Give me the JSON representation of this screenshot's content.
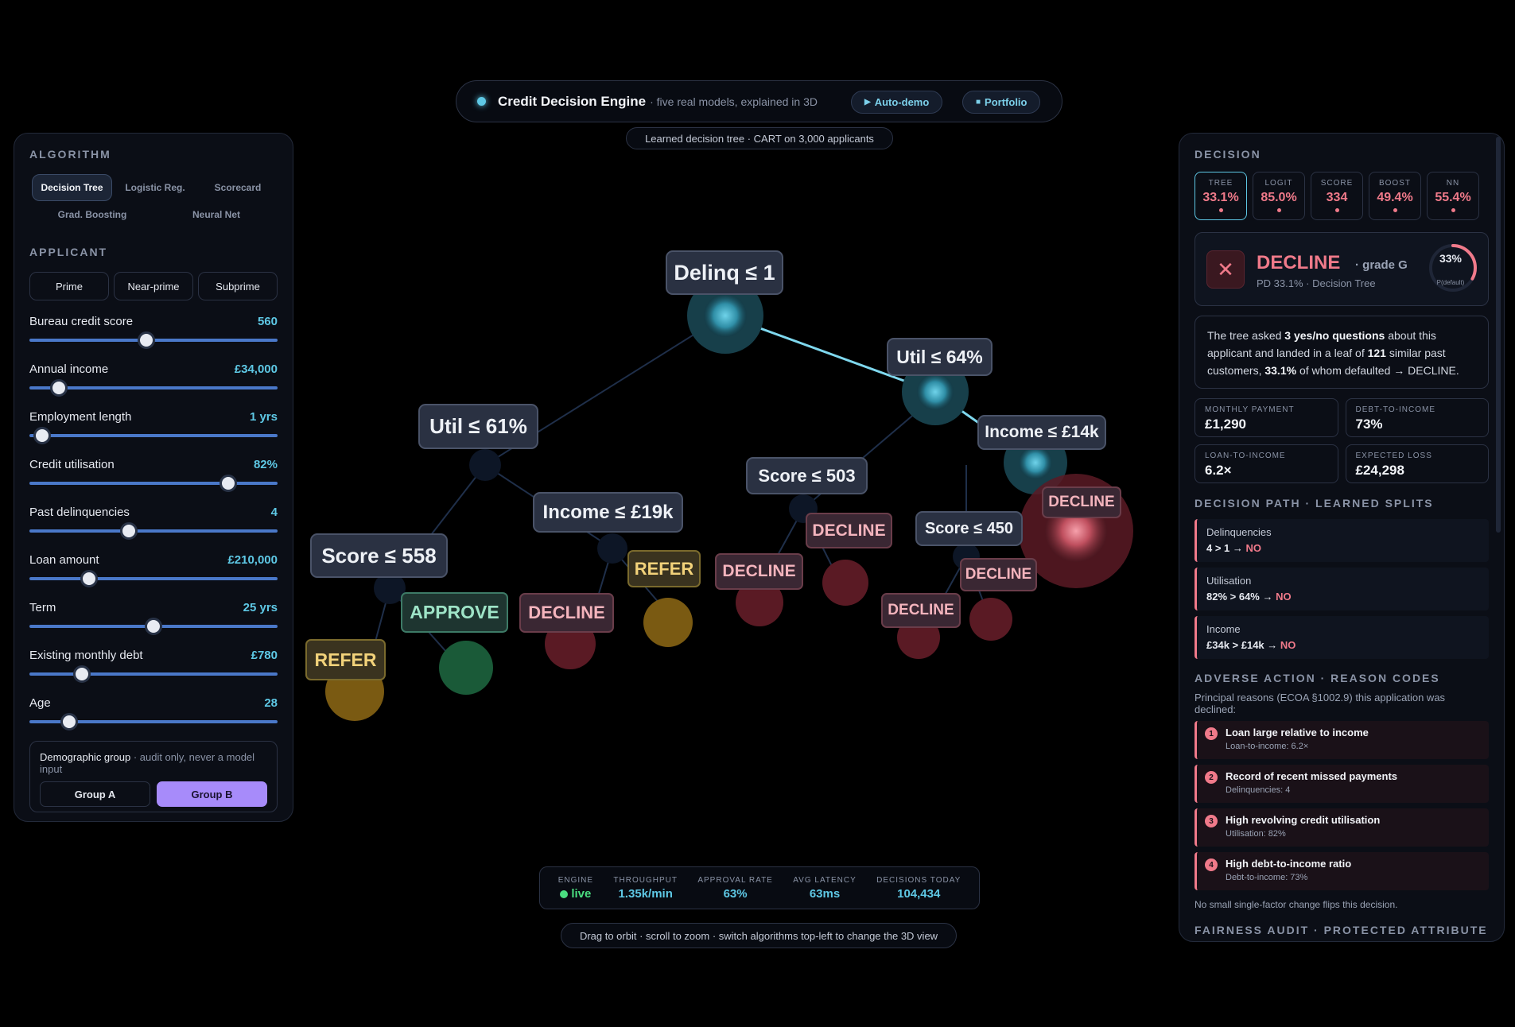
{
  "header": {
    "title": "Credit Decision Engine",
    "subtitle": "· five real models, explained in 3D",
    "autodemo_label": "Auto-demo",
    "portfolio_label": "Portfolio",
    "model_caption": "Learned decision tree · CART on 3,000 applicants"
  },
  "left": {
    "algorithm_title": "ALGORITHM",
    "algorithms": [
      "Decision Tree",
      "Logistic Reg.",
      "Scorecard",
      "Grad. Boosting",
      "Neural Net"
    ],
    "selected_algorithm": "Decision Tree",
    "applicant_title": "APPLICANT",
    "presets": [
      "Prime",
      "Near-prime",
      "Subprime"
    ],
    "sliders": [
      {
        "label": "Bureau credit score",
        "value": "560",
        "level": 0.47
      },
      {
        "label": "Annual income",
        "value": "£34,000",
        "level": 0.12
      },
      {
        "label": "Employment length",
        "value": "1 yrs",
        "level": 0.05
      },
      {
        "label": "Credit utilisation",
        "value": "82%",
        "level": 0.8
      },
      {
        "label": "Past delinquencies",
        "value": "4",
        "level": 0.4
      },
      {
        "label": "Loan amount",
        "value": "£210,000",
        "level": 0.24
      },
      {
        "label": "Term",
        "value": "25 yrs",
        "level": 0.5
      },
      {
        "label": "Existing monthly debt",
        "value": "£780",
        "level": 0.21
      },
      {
        "label": "Age",
        "value": "28",
        "level": 0.16
      }
    ],
    "demographic_title": "Demographic group",
    "demographic_note": "· audit only, never a model input",
    "groups": [
      "Group A",
      "Group B"
    ],
    "selected_group": "Group B"
  },
  "right": {
    "decision_title": "DECISION",
    "scores": [
      {
        "key": "TREE",
        "value": "33.1%"
      },
      {
        "key": "LOGIT",
        "value": "85.0%"
      },
      {
        "key": "SCORE",
        "value": "334"
      },
      {
        "key": "BOOST",
        "value": "49.4%"
      },
      {
        "key": "NN",
        "value": "55.4%"
      }
    ],
    "verdict": "DECLINE",
    "grade": "· grade G",
    "pd_line": "PD 33.1% · Decision Tree",
    "ring_pct": "33%",
    "ring_label": "P(default)",
    "ring_fraction": 0.331,
    "explain_1": "The tree asked ",
    "explain_2": "3 yes/no questions",
    "explain_3": " about this applicant and landed in a leaf of ",
    "explain_4": "121",
    "explain_5": " similar past customers, ",
    "explain_6": "33.1%",
    "explain_7": " of whom defaulted → DECLINE.",
    "metrics": [
      {
        "key": "MONTHLY PAYMENT",
        "value": "£1,290"
      },
      {
        "key": "DEBT-TO-INCOME",
        "value": "73%"
      },
      {
        "key": "LOAN-TO-INCOME",
        "value": "6.2×"
      },
      {
        "key": "EXPECTED LOSS",
        "value": "£24,298"
      }
    ],
    "path_title": "DECISION PATH · LEARNED SPLITS",
    "path": [
      {
        "feature": "Delinquencies",
        "rule": "4 > 1 →",
        "outcome": "NO"
      },
      {
        "feature": "Utilisation",
        "rule": "82% > 64% →",
        "outcome": "NO"
      },
      {
        "feature": "Income",
        "rule": "£34k > £14k →",
        "outcome": "NO"
      }
    ],
    "adverse_title": "ADVERSE ACTION · REASON CODES",
    "adverse_intro": "Principal reasons (ECOA §1002.9) this application was declined:",
    "reasons": [
      {
        "n": "1",
        "title": "Loan large relative to income",
        "detail": "Loan-to-income: 6.2×"
      },
      {
        "n": "2",
        "title": "Record of recent missed payments",
        "detail": "Delinquencies: 4"
      },
      {
        "n": "3",
        "title": "High revolving credit utilisation",
        "detail": "Utilisation: 82%"
      },
      {
        "n": "4",
        "title": "High debt-to-income ratio",
        "detail": "Debt-to-income: 73%"
      }
    ],
    "flip_note": "No small single-factor change flips this decision.",
    "fairness_title": "FAIRNESS AUDIT · PROTECTED ATTRIBUTE"
  },
  "tree": {
    "nodes": [
      "Delinq ≤ 1",
      "Util ≤ 64%",
      "Util ≤ 61%",
      "Income ≤ £14k",
      "Score ≤ 503",
      "Income ≤ £19k",
      "Score ≤ 558",
      "Score ≤ 450"
    ],
    "leaves": [
      "DECLINE",
      "DECLINE",
      "DECLINE",
      "REFER",
      "DECLINE",
      "APPROVE",
      "REFER",
      "DECLINE",
      "DECLINE"
    ]
  },
  "stats": [
    {
      "key": "ENGINE",
      "value": "live"
    },
    {
      "key": "THROUGHPUT",
      "value": "1.35k/min"
    },
    {
      "key": "APPROVAL RATE",
      "value": "63%"
    },
    {
      "key": "AVG LATENCY",
      "value": "63ms"
    },
    {
      "key": "DECISIONS TODAY",
      "value": "104,434"
    }
  ],
  "hint": "Drag to orbit · scroll to zoom · switch algorithms top-left to change the 3D view",
  "colors": {
    "accent": "#5ec8e5",
    "decline": "#f07a8a",
    "approve": "#4ade80",
    "refer": "#f2d27a",
    "group_selected": "#a78bfa"
  }
}
